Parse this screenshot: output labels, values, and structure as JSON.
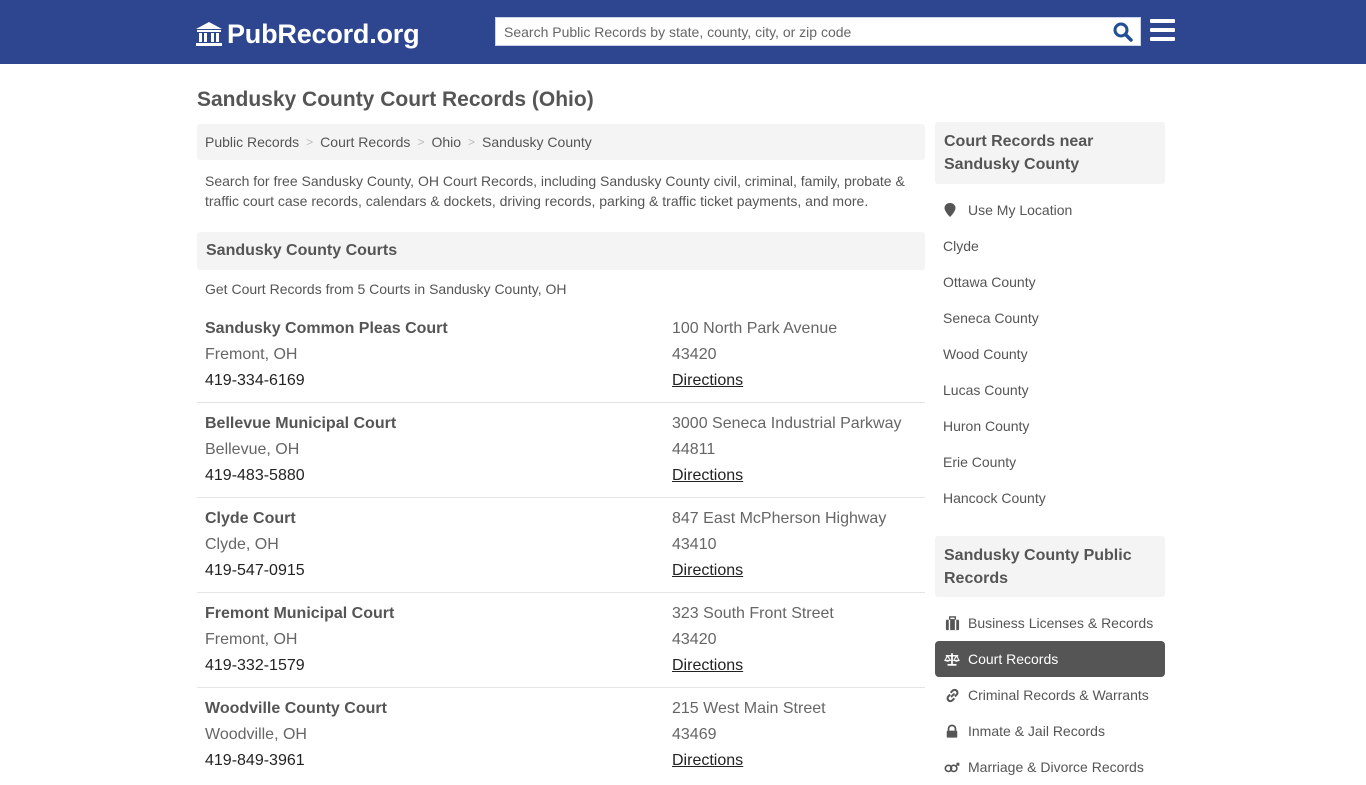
{
  "header": {
    "logo_text": "PubRecord.org",
    "search_placeholder": "Search Public Records by state, county, city, or zip code",
    "search_value": ""
  },
  "page": {
    "title": "Sandusky County Court Records (Ohio)",
    "breadcrumb": [
      "Public Records",
      "Court Records",
      "Ohio",
      "Sandusky County"
    ],
    "breadcrumb_separator": ">",
    "intro": "Search for free Sandusky County, OH Court Records, including Sandusky County civil, criminal, family, probate & traffic court case records, calendars & dockets, driving records, parking & traffic ticket payments, and more."
  },
  "courts_section": {
    "heading": "Sandusky County Courts",
    "subheading": "Get Court Records from 5 Courts in Sandusky County, OH",
    "directions_label": "Directions",
    "courts": [
      {
        "name": "Sandusky Common Pleas Court",
        "city": "Fremont, OH",
        "phone": "419-334-6169",
        "address": "100 North Park Avenue",
        "zip": "43420"
      },
      {
        "name": "Bellevue Municipal Court",
        "city": "Bellevue, OH",
        "phone": "419-483-5880",
        "address": "3000 Seneca Industrial Parkway",
        "zip": "44811"
      },
      {
        "name": "Clyde Court",
        "city": "Clyde, OH",
        "phone": "419-547-0915",
        "address": "847 East McPherson Highway",
        "zip": "43410"
      },
      {
        "name": "Fremont Municipal Court",
        "city": "Fremont, OH",
        "phone": "419-332-1579",
        "address": "323 South Front Street",
        "zip": "43420"
      },
      {
        "name": "Woodville County Court",
        "city": "Woodville, OH",
        "phone": "419-849-3961",
        "address": "215 West Main Street",
        "zip": "43469"
      }
    ]
  },
  "sidebar": {
    "near": {
      "heading": "Court Records near Sandusky County",
      "use_location": "Use My Location",
      "items": [
        "Clyde",
        "Ottawa County",
        "Seneca County",
        "Wood County",
        "Lucas County",
        "Huron County",
        "Erie County",
        "Hancock County"
      ]
    },
    "public_records": {
      "heading": "Sandusky County Public Records",
      "items": [
        {
          "label": "Business Licenses & Records",
          "icon": "briefcase-icon",
          "active": false
        },
        {
          "label": "Court Records",
          "icon": "scales-icon",
          "active": true
        },
        {
          "label": "Criminal Records & Warrants",
          "icon": "link-icon",
          "active": false
        },
        {
          "label": "Inmate & Jail Records",
          "icon": "lock-icon",
          "active": false
        },
        {
          "label": "Marriage & Divorce Records",
          "icon": "gender-icon",
          "active": false
        }
      ]
    }
  },
  "colors": {
    "header_bg": "#2e4690",
    "search_icon": "#1f4f94",
    "panel_bg": "#f4f4f4",
    "active_item_bg": "#555555",
    "text": "#555555"
  }
}
